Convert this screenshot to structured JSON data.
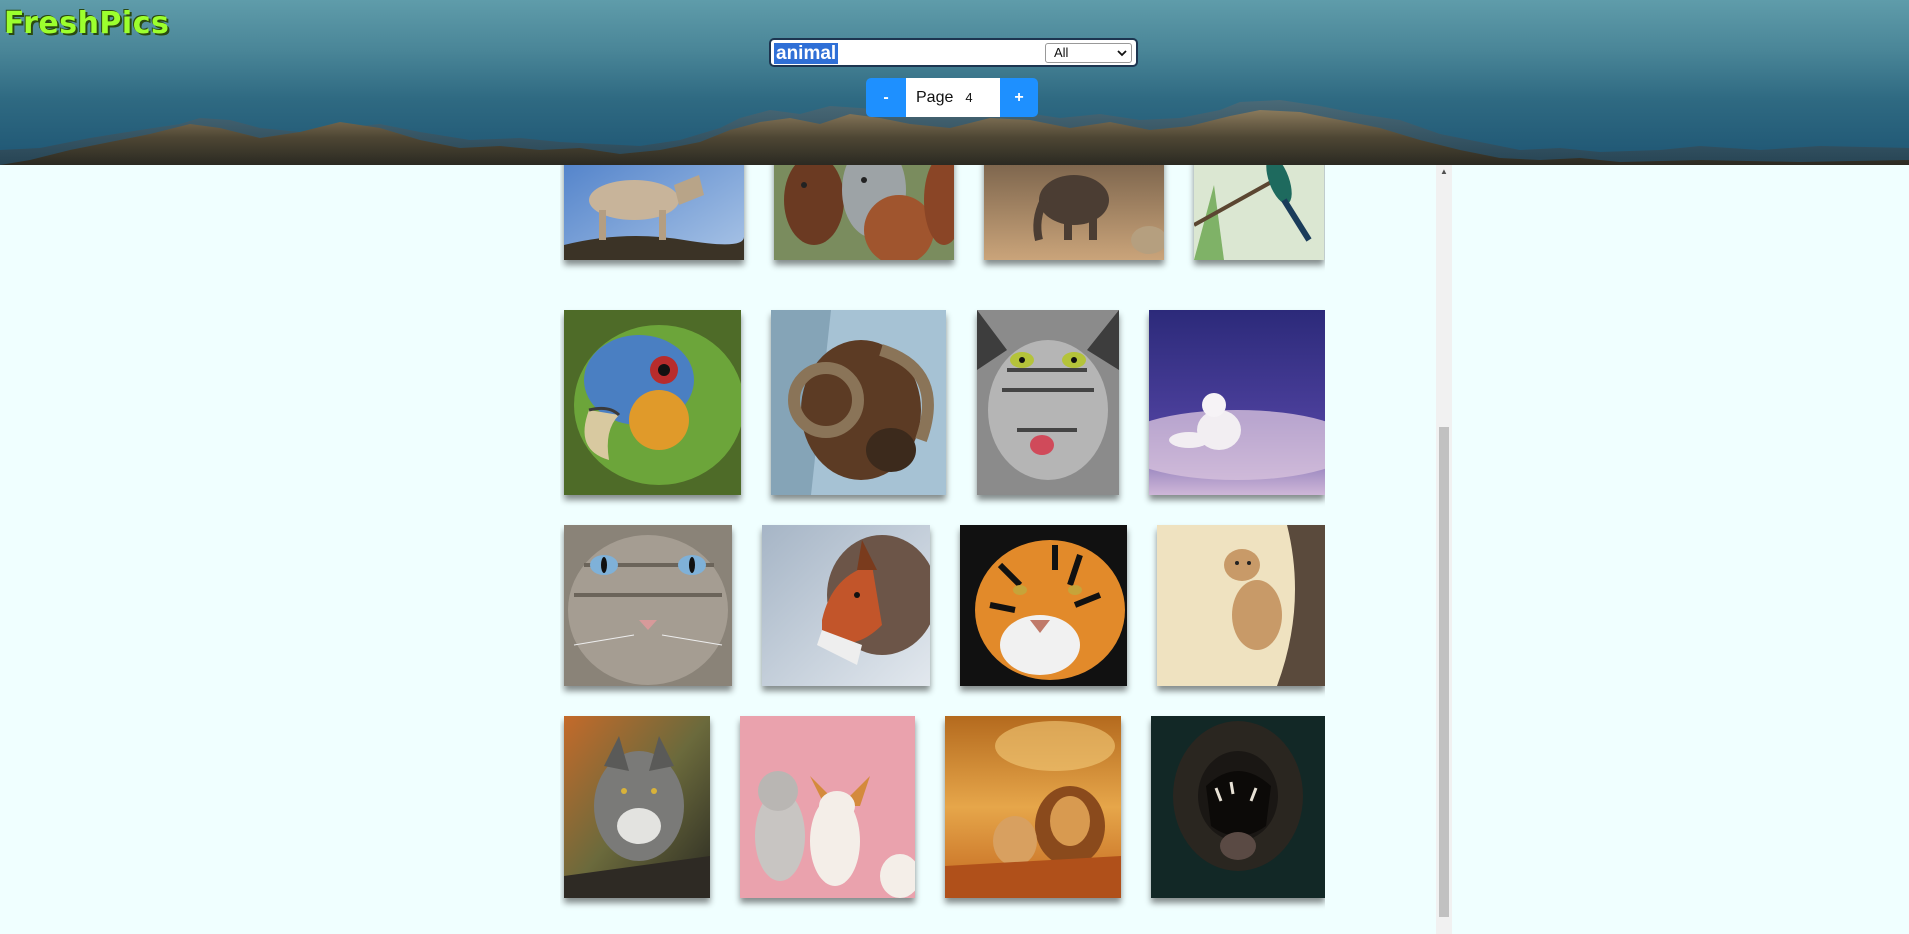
{
  "app": {
    "logo": "FreshPics"
  },
  "search": {
    "query": "animal",
    "filter_selected": "All"
  },
  "pager": {
    "prev_label": "-",
    "page_label": "Page",
    "page_value": "4",
    "next_label": "+"
  },
  "gallery": {
    "photos": [
      {
        "name": "wolf-on-rock-photo",
        "icon": "wolf"
      },
      {
        "name": "horses-photo",
        "icon": "horses"
      },
      {
        "name": "elephant-calf-photo",
        "icon": "elephant"
      },
      {
        "name": "hummingbird-photo",
        "icon": "hummingbird"
      },
      {
        "name": "parrot-photo",
        "icon": "parrot"
      },
      {
        "name": "ram-photo",
        "icon": "ram"
      },
      {
        "name": "tabby-cat-photo",
        "icon": "cat"
      },
      {
        "name": "arctic-fox-photo",
        "icon": "arctic-fox"
      },
      {
        "name": "blue-eyed-cat-photo",
        "icon": "cat"
      },
      {
        "name": "red-fox-photo",
        "icon": "fox"
      },
      {
        "name": "tiger-photo",
        "icon": "tiger"
      },
      {
        "name": "lion-cub-photo",
        "icon": "lion-cub"
      },
      {
        "name": "grey-wolf-photo",
        "icon": "wolf"
      },
      {
        "name": "dogs-photo",
        "icon": "dogs"
      },
      {
        "name": "lions-photo",
        "icon": "lions"
      },
      {
        "name": "roaring-lion-photo",
        "icon": "lion"
      }
    ]
  },
  "colors": {
    "background": "#f0ffff",
    "logo": "#9cff2e",
    "accent": "#1e90ff",
    "selection": "#2f6fd6"
  }
}
